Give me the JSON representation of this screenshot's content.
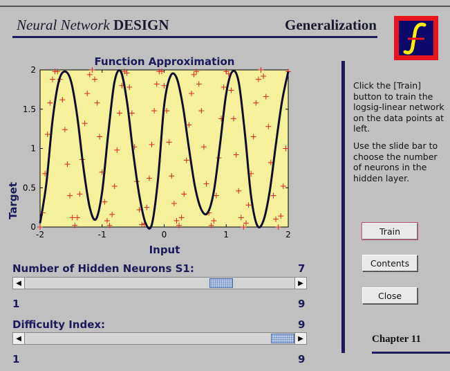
{
  "header": {
    "brand_italic": "Neural Network",
    "brand_bold": "DESIGN",
    "page_title": "Generalization"
  },
  "colors": {
    "accent": "#1a1a5a",
    "plot_bg": "#f5f09a",
    "fit_line": "#0d0d33",
    "data_points": "#e02020",
    "logo_red": "#e8141e",
    "logo_yellow": "#ffee00",
    "logo_navy": "#0a0a6a"
  },
  "instructions": {
    "p1": "Click the [Train] button to train the logsig-linear network on the data points at left.",
    "p2": "Use the slide bar to choose the number of neurons in the hidden layer."
  },
  "buttons": {
    "train": "Train",
    "contents": "Contents",
    "close": "Close"
  },
  "chapter": "Chapter 11",
  "sliders": {
    "neurons": {
      "label": "Number of Hidden Neurons S1:",
      "value": 7,
      "value_text": "7",
      "min": 1,
      "max": 9,
      "min_text": "1",
      "max_text": "9"
    },
    "difficulty": {
      "label": "Difficulty Index:",
      "value": 9,
      "value_text": "9",
      "min": 1,
      "max": 9,
      "min_text": "1",
      "max_text": "9"
    }
  },
  "icons": {
    "logo": "function-f-icon",
    "arrow_left": "◀",
    "arrow_right": "▶"
  },
  "chart_data": {
    "type": "line",
    "title": "Function Approximation",
    "xlabel": "Input",
    "ylabel": "Target",
    "xlim": [
      -2,
      2
    ],
    "ylim": [
      0,
      2
    ],
    "xticks": [
      -2,
      -1,
      0,
      1,
      2
    ],
    "xtick_labels": [
      "-2",
      "-1",
      "0",
      "1",
      "2"
    ],
    "yticks": [
      0,
      0.5,
      1,
      1.5,
      2
    ],
    "ytick_labels": [
      "0",
      "0.5",
      "1",
      "1.5",
      "2"
    ],
    "grid": false,
    "series": [
      {
        "kind": "line",
        "x": [
          -2.0,
          -1.9,
          -1.8,
          -1.7,
          -1.6,
          -1.5,
          -1.4,
          -1.3,
          -1.2,
          -1.1,
          -1.0,
          -0.9,
          -0.8,
          -0.7,
          -0.6,
          -0.5,
          -0.4,
          -0.3,
          -0.2,
          -0.1,
          0.0,
          0.1,
          0.2,
          0.3,
          0.4,
          0.5,
          0.6,
          0.7,
          0.8,
          0.9,
          1.0,
          1.1,
          1.2,
          1.3,
          1.4,
          1.5,
          1.6,
          1.7,
          1.8,
          1.9,
          2.0
        ],
        "y": [
          0.05,
          0.55,
          1.35,
          1.85,
          1.98,
          1.85,
          1.4,
          0.75,
          0.25,
          0.1,
          0.45,
          1.2,
          1.85,
          1.98,
          1.6,
          0.95,
          0.4,
          0.05,
          0.03,
          0.6,
          1.55,
          1.92,
          1.9,
          1.55,
          1.0,
          0.5,
          0.22,
          0.18,
          0.45,
          1.05,
          1.7,
          1.98,
          1.85,
          1.2,
          0.4,
          0.02,
          0.08,
          0.45,
          1.05,
          1.6,
          1.98
        ]
      },
      {
        "kind": "points",
        "x": [
          -2.0,
          -1.96,
          -1.92,
          -1.88,
          -1.84,
          -1.8,
          -1.76,
          -1.72,
          -1.68,
          -1.64,
          -1.6,
          -1.56,
          -1.52,
          -1.48,
          -1.44,
          -1.4,
          -1.36,
          -1.32,
          -1.28,
          -1.24,
          -1.2,
          -1.16,
          -1.12,
          -1.08,
          -1.04,
          -1.0,
          -0.96,
          -0.92,
          -0.88,
          -0.84,
          -0.8,
          -0.76,
          -0.72,
          -0.68,
          -0.64,
          -0.6,
          -0.56,
          -0.52,
          -0.48,
          -0.44,
          -0.4,
          -0.36,
          -0.32,
          -0.28,
          -0.24,
          -0.2,
          -0.16,
          -0.12,
          -0.08,
          -0.04,
          0.0,
          0.04,
          0.08,
          0.12,
          0.16,
          0.2,
          0.24,
          0.28,
          0.32,
          0.36,
          0.4,
          0.44,
          0.48,
          0.52,
          0.56,
          0.6,
          0.64,
          0.68,
          0.72,
          0.76,
          0.8,
          0.84,
          0.88,
          0.92,
          0.96,
          1.0,
          1.04,
          1.08,
          1.12,
          1.16,
          1.2,
          1.24,
          1.28,
          1.32,
          1.36,
          1.4,
          1.44,
          1.48,
          1.52,
          1.56,
          1.6,
          1.64,
          1.68,
          1.72,
          1.76,
          1.8,
          1.84,
          1.88,
          1.92,
          1.96,
          2.0
        ],
        "y": [
          0.0,
          0.18,
          0.68,
          1.18,
          1.58,
          1.88,
          1.98,
          1.98,
          1.88,
          1.62,
          1.24,
          0.8,
          0.4,
          0.12,
          0.02,
          0.12,
          0.42,
          0.86,
          1.32,
          1.7,
          1.94,
          2.0,
          1.88,
          1.58,
          1.15,
          0.7,
          0.32,
          0.08,
          0.02,
          0.16,
          0.52,
          0.98,
          1.45,
          1.8,
          1.98,
          1.96,
          1.78,
          1.45,
          1.02,
          0.58,
          0.22,
          0.03,
          0.04,
          0.25,
          0.62,
          1.05,
          1.48,
          1.82,
          1.98,
          1.98,
          1.8,
          1.48,
          1.08,
          0.65,
          0.3,
          0.08,
          0.02,
          0.12,
          0.42,
          0.85,
          1.3,
          1.7,
          1.94,
          1.98,
          1.82,
          1.48,
          1.02,
          0.55,
          0.18,
          0.02,
          0.08,
          0.4,
          0.88,
          1.38,
          1.78,
          1.98,
          1.95,
          1.74,
          1.38,
          0.92,
          0.46,
          0.12,
          0.0,
          0.05,
          0.28,
          0.68,
          1.15,
          1.58,
          1.88,
          2.0,
          1.92,
          1.66,
          1.28,
          0.82,
          0.4,
          0.1,
          0.0,
          0.14,
          0.52,
          1.0,
          1.98
        ]
      }
    ]
  }
}
